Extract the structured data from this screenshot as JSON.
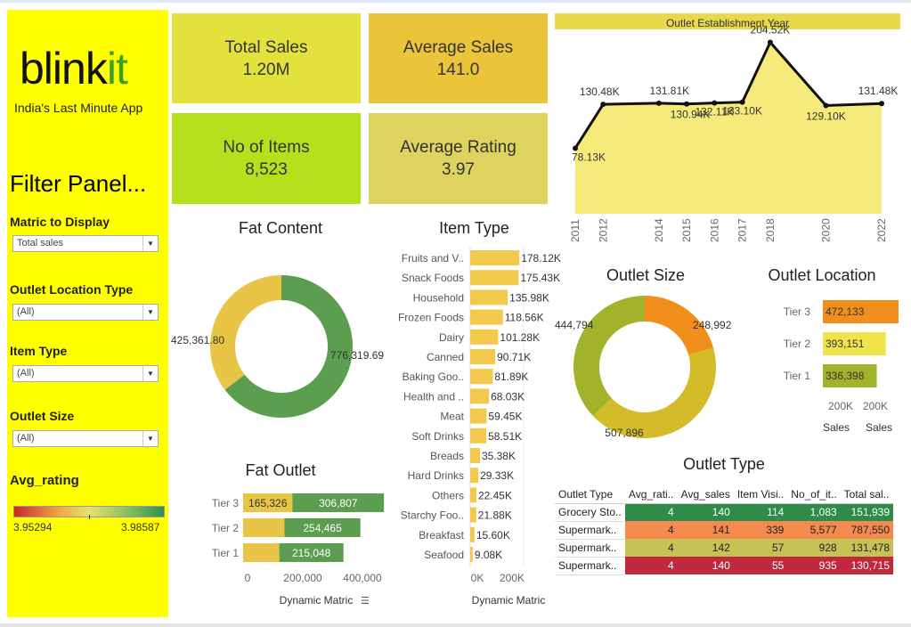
{
  "sidebar": {
    "logo_main": "blink",
    "logo_accent": "it",
    "tagline": "India's Last Minute App",
    "filter_title": "Filter Panel...",
    "filters": [
      {
        "label": "Matric to Display",
        "value": "Total sales"
      },
      {
        "label": "Outlet Location Type",
        "value": "(All)"
      },
      {
        "label": "Item Type",
        "value": "(All)"
      },
      {
        "label": "Outlet Size",
        "value": "(All)"
      }
    ],
    "legend_label": "Avg_rating",
    "legend_min": "3.95294",
    "legend_max": "3.98587",
    "colors": {
      "panel": "#ffff00",
      "logo_accent": "#3a9e25"
    }
  },
  "kpis": [
    {
      "label": "Total Sales",
      "value": "1.20M",
      "color": "#e3e23d"
    },
    {
      "label": "Average Sales",
      "value": "141.0",
      "color": "#ecc439"
    },
    {
      "label": "No of Items",
      "value": "8,523",
      "color": "#b4e11c"
    },
    {
      "label": "Average Rating",
      "value": "3.97",
      "color": "#ddd35e"
    }
  ],
  "titles": {
    "establishment": "Outlet Establishment Year",
    "fat_content": "Fat Content",
    "item_type": "Item Type",
    "fat_outlet": "Fat Outlet",
    "outlet_size": "Outlet Size",
    "outlet_location": "Outlet Location",
    "outlet_type": "Outlet Type",
    "dynamic_matric": "Dynamic Matric",
    "sales_axis": "Sales"
  },
  "chart_data": [
    {
      "id": "establishment",
      "type": "area",
      "title": "Outlet Establishment Year",
      "x": [
        "2011",
        "2012",
        "2014",
        "2015",
        "2016",
        "2017",
        "2018",
        "2020",
        "2022"
      ],
      "values": [
        78.13,
        130.48,
        131.81,
        130.94,
        132.11,
        133.1,
        204.52,
        129.1,
        131.48
      ],
      "labels": [
        "78.13K",
        "130.48K",
        "131.81K",
        "130.94K",
        "132.11K",
        "133.10K",
        "204.52K",
        "129.10K",
        "131.48K"
      ],
      "colors": {
        "area": "#f6eb7a",
        "line": "#111111"
      }
    },
    {
      "id": "fat_content",
      "type": "pie",
      "title": "Fat Content",
      "values": [
        776319.69,
        425361.8
      ],
      "labels": [
        "776,319.69",
        "425,361.80"
      ],
      "colors": [
        "#5b9e4f",
        "#e8c547"
      ]
    },
    {
      "id": "item_type",
      "type": "bar",
      "title": "Item Type",
      "categories": [
        "Fruits and V..",
        "Snack Foods",
        "Household",
        "Frozen Foods",
        "Dairy",
        "Canned",
        "Baking Goo..",
        "Health and ..",
        "Meat",
        "Soft Drinks",
        "Breads",
        "Hard Drinks",
        "Others",
        "Starchy Foo..",
        "Breakfast",
        "Seafood"
      ],
      "values": [
        178.12,
        175.43,
        135.98,
        118.56,
        101.28,
        90.71,
        81.89,
        68.03,
        59.45,
        58.51,
        35.38,
        29.33,
        22.45,
        21.88,
        15.6,
        9.08
      ],
      "labels": [
        "178.12K",
        "175.43K",
        "135.98K",
        "118.56K",
        "101.28K",
        "90.71K",
        "81.89K",
        "68.03K",
        "59.45K",
        "58.51K",
        "35.38K",
        "29.33K",
        "22.45K",
        "21.88K",
        "15.60K",
        "9.08K"
      ],
      "xticks": [
        "0K",
        "200K"
      ],
      "xlabel": "Dynamic Matric",
      "color": "#f2c94c"
    },
    {
      "id": "fat_outlet",
      "type": "bar",
      "title": "Fat Outlet",
      "categories": [
        "Tier 3",
        "Tier 2",
        "Tier 1"
      ],
      "series": [
        {
          "values": [
            165326,
            138685,
            121349
          ],
          "labels": [
            "165,326",
            "",
            ""
          ],
          "color": "#e8c547"
        },
        {
          "values": [
            306807,
            254465,
            215048
          ],
          "labels": [
            "306,807",
            "254,465",
            "215,048"
          ],
          "color": "#5b9e4f"
        }
      ],
      "xticks": [
        "0",
        "200,000",
        "400,000"
      ],
      "xlim": [
        0,
        400000
      ],
      "xlabel": "Dynamic Matric"
    },
    {
      "id": "outlet_size",
      "type": "pie",
      "title": "Outlet Size",
      "values": [
        248992,
        507896,
        444794
      ],
      "labels": [
        "248,992",
        "507,896",
        "444,794"
      ],
      "colors": [
        "#f28e1c",
        "#d4bb2a",
        "#a0b32a"
      ]
    },
    {
      "id": "outlet_location",
      "type": "bar",
      "title": "Outlet Location",
      "categories": [
        "Tier 3",
        "Tier 2",
        "Tier 1"
      ],
      "values": [
        472133,
        393151,
        336398
      ],
      "labels": [
        "472,133",
        "393,151",
        "336,398"
      ],
      "colors": [
        "#f28e1c",
        "#efe44a",
        "#a0b32a"
      ],
      "xticks": [
        "200K",
        "200K"
      ],
      "xlabels": [
        "Sales",
        "Sales"
      ]
    },
    {
      "id": "outlet_type",
      "type": "table",
      "title": "Outlet Type",
      "columns": [
        "Outlet Type",
        "Avg_rati..",
        "Avg_sales",
        "Item Visi..",
        "No_of_it..",
        "Total sal.."
      ],
      "rows": [
        {
          "cells": [
            "Grocery Sto..",
            "4",
            "140",
            "114",
            "1,083",
            "151,939"
          ],
          "color": "#2e8b48"
        },
        {
          "cells": [
            "Supermark..",
            "4",
            "141",
            "339",
            "5,577",
            "787,550"
          ],
          "color": "#f58a4e"
        },
        {
          "cells": [
            "Supermark..",
            "4",
            "142",
            "57",
            "928",
            "131,478"
          ],
          "color": "#c7c255"
        },
        {
          "cells": [
            "Supermark..",
            "4",
            "140",
            "55",
            "935",
            "130,715"
          ],
          "color": "#c0283c"
        }
      ]
    }
  ]
}
